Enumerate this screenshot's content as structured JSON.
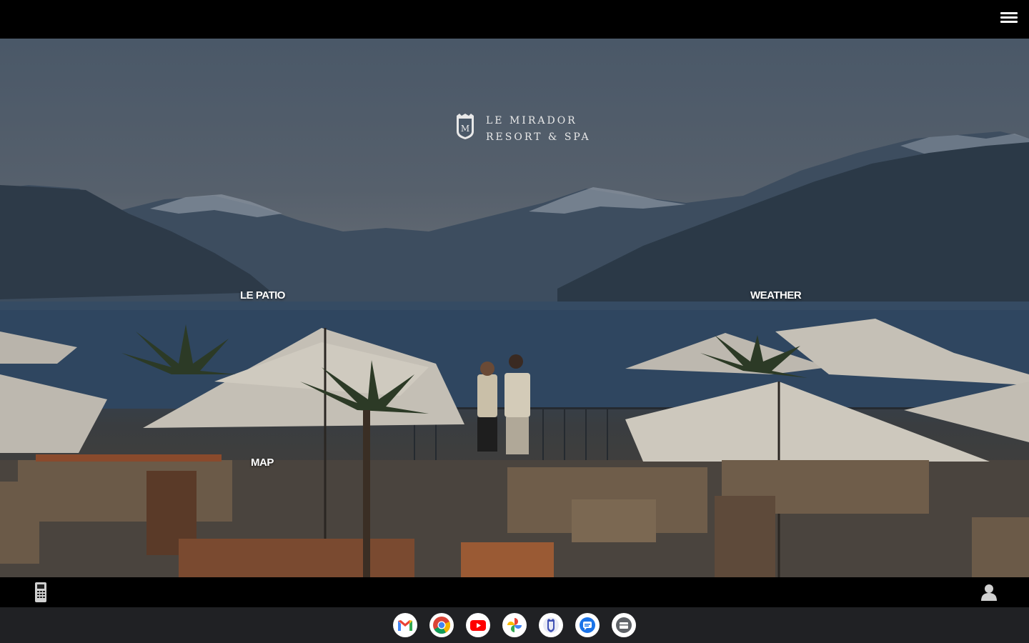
{
  "brand": {
    "line1": "LE MIRADOR",
    "line2": "RESORT & SPA",
    "crest_letter": "M"
  },
  "hotspots": {
    "le_patio": "LE PATIO",
    "weather": "WEATHER",
    "map": "MAP"
  },
  "top_bar": {
    "menu_icon": "hamburger-menu-icon"
  },
  "bottom_bar": {
    "left_icon": "phone-handset-icon",
    "right_icon": "user-profile-icon"
  },
  "shelf": {
    "apps": [
      "gmail",
      "chrome",
      "youtube",
      "google-photos",
      "hotel-app",
      "messages",
      "files"
    ]
  },
  "colors": {
    "bar": "#000000",
    "shelf": "#202124",
    "text": "#ffffff"
  }
}
